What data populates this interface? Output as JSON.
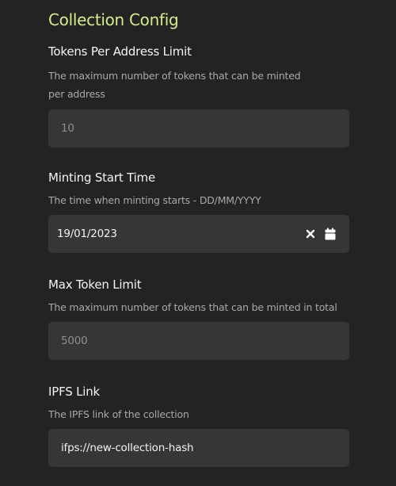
{
  "section": {
    "title": "Collection Config"
  },
  "fields": {
    "tokens_per_address": {
      "label": "Tokens Per Address Limit",
      "description": "The maximum number of tokens that can be minted per address",
      "placeholder": "10",
      "value": ""
    },
    "minting_start_time": {
      "label": "Minting Start Time",
      "description": "The time when minting starts - DD/MM/YYYY",
      "value": "19/01/2023",
      "clear_icon": "close-icon",
      "calendar_icon": "calendar-icon"
    },
    "max_token_limit": {
      "label": "Max Token Limit",
      "description": "The maximum number of tokens that can be minted in total",
      "placeholder": "5000",
      "value": ""
    },
    "ipfs_link": {
      "label": "IPFS Link",
      "description": "The IPFS link of the collection",
      "value": "ifps://new-collection-hash"
    }
  },
  "colors": {
    "background": "#232323",
    "input_background": "#363636",
    "accent_title": "#d4ec8a",
    "label": "#f5f5f5",
    "description": "#a9a9a9",
    "placeholder": "#8e8e8e"
  }
}
